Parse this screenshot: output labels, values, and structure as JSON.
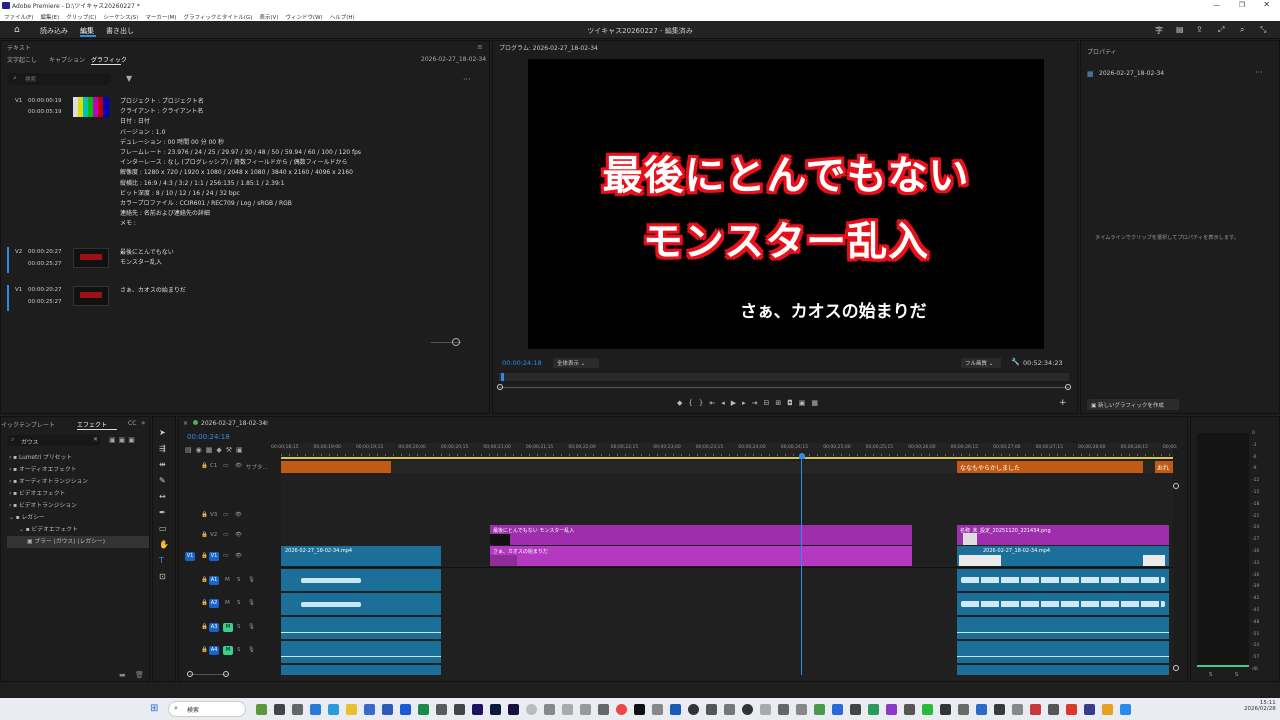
{
  "window": {
    "title": "Adobe Premiere - D:\\ツイキャス20260227 *"
  },
  "menu": [
    "ファイル(F)",
    "編集(E)",
    "クリップ(C)",
    "シーケンス(S)",
    "マーカー(M)",
    "グラフィックとタイトル(G)",
    "表示(V)",
    "ウィンドウ(W)",
    "ヘルプ(H)"
  ],
  "appbar": {
    "tabs": [
      "読み込み",
      "編集",
      "書き出し"
    ],
    "center_title": "ツイキャス20260227 - 編集済み"
  },
  "text_panel": {
    "title": "テキスト",
    "tabs": [
      "文字起こし",
      "キャプション",
      "グラフィック"
    ],
    "sequence": "2026-02-27_18-02-34",
    "search_placeholder": "検索",
    "items": [
      {
        "track": "V1",
        "in": "00:00:00:19",
        "out": "00:00:05:19",
        "lines": [
          "プロジェクト : プロジェクト名",
          "クライアント : クライアント名",
          "日付 : 日付",
          "バージョン : 1.0",
          "デュレーション : 00 時間 00 分 00 秒",
          "フレームレート : 23.976 / 24 / 25 / 29.97 / 30 / 48 / 50 / 59.94 / 60 / 100 / 120 fps",
          "インターレース : なし (プログレッシブ) / 奇数フィールドから / 偶数フィールドから",
          "解像度 : 1280 x 720 / 1920 x 1080 / 2048 x 1080 / 3840 x 2160 / 4096 x 2160",
          "縦横比 : 16:9 / 4:3 / 3:2 / 1:1 / 256:135 / 1.85:1 / 2.39:1",
          "ビット深度 : 8 / 10 / 12 / 16 / 24 / 32 bpc",
          "カラープロファイル : CCIR601 / REC709 / Log / sRGB / RGB",
          "連絡先 : 名前および連絡先の詳細",
          "メモ :"
        ]
      },
      {
        "track": "V2",
        "in": "00:00:20:27",
        "out": "00:00:25:27",
        "lines": [
          "最後にとんでもない",
          "モンスター乱入"
        ]
      },
      {
        "track": "V1",
        "in": "00:00:20:27",
        "out": "00:00:25:27",
        "lines": [
          "さぁ、カオスの始まりだ"
        ]
      }
    ]
  },
  "program": {
    "title": "プログラム: 2026-02-27_18-02-34",
    "overlay_line1": "最後にとんでもない",
    "overlay_line2": "モンスター乱入",
    "subtitle": "さぁ、カオスの始まりだ",
    "timecode": "00:00:24:18",
    "fit": "全体表示",
    "quality": "フル画質",
    "duration": "00:52:34:23"
  },
  "properties": {
    "title": "プロパティ",
    "sequence": "2026-02-27_18-02-34",
    "empty_msg": "タイムラインでクリップを選択してプロパティを表示します。",
    "new_graphic": "新しいグラフィックを作成"
  },
  "effects": {
    "tabs": [
      "イックテンプレート",
      "エフェクト",
      "CC"
    ],
    "search_value": "ガウス",
    "tree": [
      "Lumetri プリセット",
      "オーディオエフェクト",
      "オーディオトランジション",
      "ビデオエフェクト",
      "ビデオトランジション",
      "レガシー",
      "ビデオエフェクト",
      "ブラー (ガウス) (レガシー)"
    ]
  },
  "timeline": {
    "sequence": "2026-02-27_18-02-34",
    "timecode": "00:00:24:18",
    "ruler": [
      "00;00;18;15",
      "00;00;19;00",
      "00;00;19;15",
      "00;00;20;00",
      "00;00;20;15",
      "00;00;21;00",
      "00;00;21;15",
      "00;00;22;00",
      "00;00;22;15",
      "00;00;23;00",
      "00;00;23;15",
      "00;00;24;00",
      "00;00;24;15",
      "00;00;25;00",
      "00;00;25;15",
      "00;00;26;00",
      "00;00;26;15",
      "00;00;27;00",
      "00;00;27;15",
      "00;00;28;00",
      "00;00;28;15",
      "00;00;"
    ],
    "caption_track": "サブタ...",
    "caption_clips": [
      "ななもやらかしました",
      "おれ"
    ],
    "tracks_video": [
      "V3",
      "V2",
      "V1"
    ],
    "tracks_audio": [
      "A1",
      "A2",
      "A3",
      "A4"
    ],
    "clips": {
      "v2_gfx": "最後にとんでもない モンスター乱入",
      "v2_png": "名称_未_設定_20251120_221434.png",
      "v1_vid": "2026-02-27_18-02-34.mp4",
      "v1_gfx": "さぁ、カオスの始まりだ",
      "v1_vid2": "2026-02-27_18-02-34.mp4"
    }
  },
  "meter_scale": [
    "0",
    "-3",
    "-6",
    "-9",
    "-12",
    "-15",
    "-18",
    "-21",
    "-24",
    "-27",
    "-30",
    "-33",
    "-36",
    "-39",
    "-42",
    "-45",
    "-48",
    "-51",
    "-54",
    "-57",
    "dB"
  ],
  "meter_labels": [
    "S",
    "S"
  ],
  "taskbar": {
    "search": "検索",
    "time": "15:11",
    "date": "2026/02/28"
  },
  "colors": {
    "accent": "#2d8ceb",
    "clip_video": "#1b6f99",
    "clip_graphic": "#9e2eac",
    "caption": "#c05a14",
    "overlay_red": "#e8101a"
  }
}
